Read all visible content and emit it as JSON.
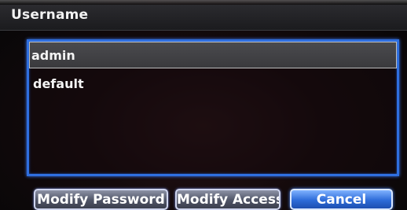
{
  "dialog": {
    "title": "Username"
  },
  "user_list": {
    "items": [
      {
        "label": "admin",
        "selected": true
      },
      {
        "label": "default",
        "selected": false
      }
    ]
  },
  "buttons": {
    "modify_password": "Modify Password",
    "modify_access": "Modify Access",
    "cancel": "Cancel"
  },
  "colors": {
    "accent_blue": "#2f6fe0",
    "selected_row": "#444448",
    "button_gray": "#4f5466",
    "button_blue": "#2d6bd8"
  }
}
